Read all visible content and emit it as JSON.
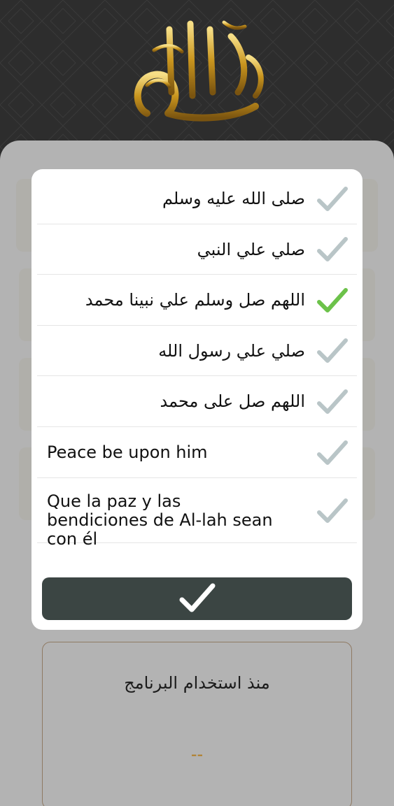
{
  "header": {
    "logo_icon": "calligraphy-rasul-allah-icon"
  },
  "options": [
    {
      "label": "صلى الله عليه وسلم",
      "dir": "rtl",
      "selected": false
    },
    {
      "label": "صلي علي النبي",
      "dir": "rtl",
      "selected": false
    },
    {
      "label": "اللهم صل وسلم علي نبينا محمد",
      "dir": "rtl",
      "selected": true
    },
    {
      "label": "صلي علي رسول الله",
      "dir": "rtl",
      "selected": false
    },
    {
      "label": "اللهم صل على محمد",
      "dir": "rtl",
      "selected": false
    },
    {
      "label": "Peace be upon him",
      "dir": "ltr",
      "selected": false
    },
    {
      "label": "Que la paz y las bendiciones de Al-lah sean con él",
      "dir": "ltr",
      "selected": false
    }
  ],
  "confirm_icon": "checkmark-icon",
  "stats": {
    "label": "منذ استخدام البرنامج",
    "value": "--"
  },
  "colors": {
    "check_selected": "#6cc24a",
    "check_unselected": "#b9c5c7",
    "confirm_button": "#3b4543",
    "accent_gold": "#b07a1e"
  }
}
